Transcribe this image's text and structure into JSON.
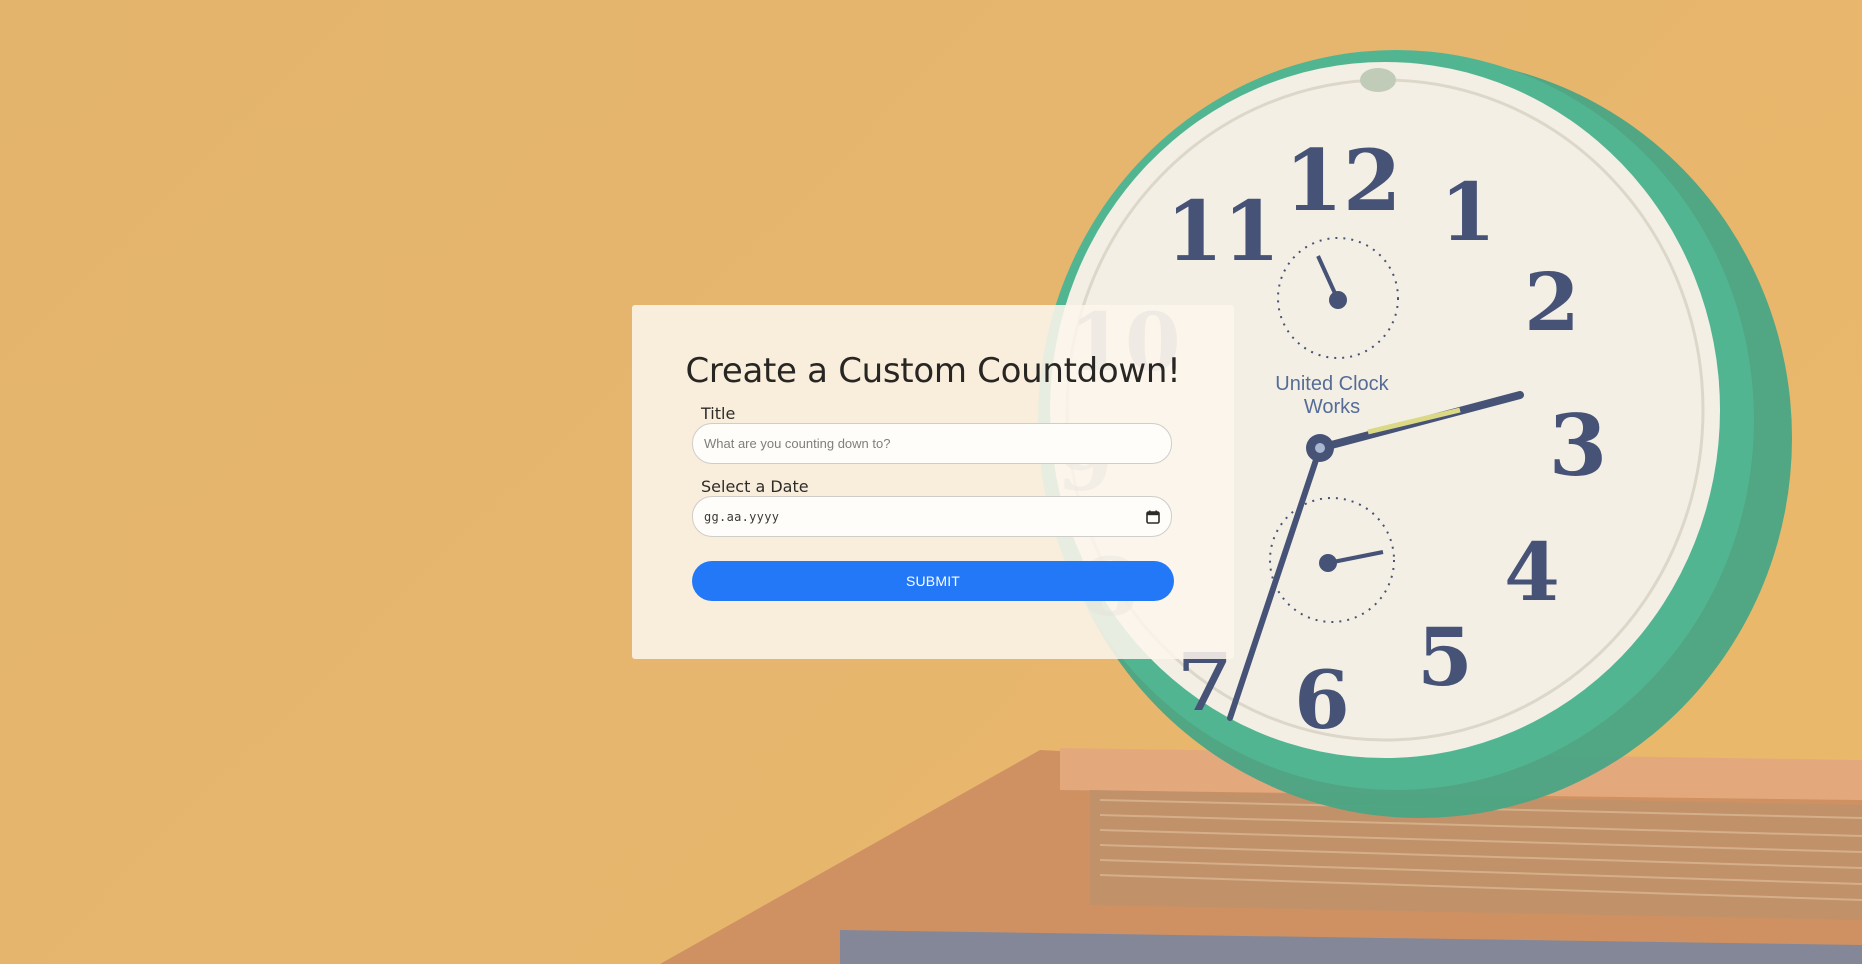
{
  "form": {
    "heading": "Create a Custom Countdown!",
    "title_label": "Title",
    "title_placeholder": "What are you counting down to?",
    "date_label": "Select a Date",
    "date_placeholder": "gg.aa.yyyy",
    "submit_label": "SUBMIT"
  },
  "background": {
    "clock": {
      "brand_line1": "United Clock",
      "brand_line2": "Works",
      "numerals": [
        "12",
        "1",
        "2",
        "3",
        "4",
        "5",
        "6",
        "7",
        "8",
        "9",
        "10",
        "11"
      ]
    }
  },
  "colors": {
    "backdrop": "#e2ad5f",
    "card": "#fcf6ee",
    "submit": "#0468fb",
    "clock_rim": "#2a9c7c"
  }
}
